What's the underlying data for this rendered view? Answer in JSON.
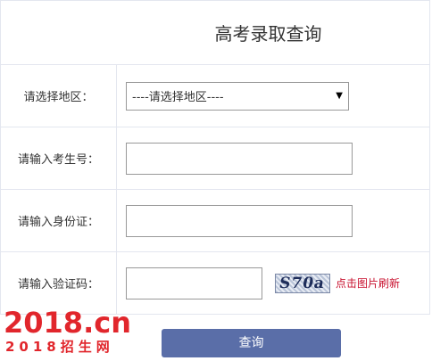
{
  "form": {
    "title": "高考录取查询",
    "region_label": "请选择地区：",
    "region_value": "----请选择地区----",
    "exam_no_label": "请输入考生号：",
    "exam_no_value": "",
    "id_label": "请输入身份证：",
    "id_value": "",
    "captcha_label": "请输入验证码：",
    "captcha_value": "",
    "captcha_text": "S70a",
    "refresh_label": "点击图片刷新",
    "submit_label": "查询"
  },
  "watermark": {
    "main": "2018.cn",
    "sub": "2018招生网"
  },
  "colors": {
    "accent": "#5a6ea8",
    "refresh_text": "#c8102e",
    "logo": "#e1262c",
    "border": "#e3e6ef"
  }
}
